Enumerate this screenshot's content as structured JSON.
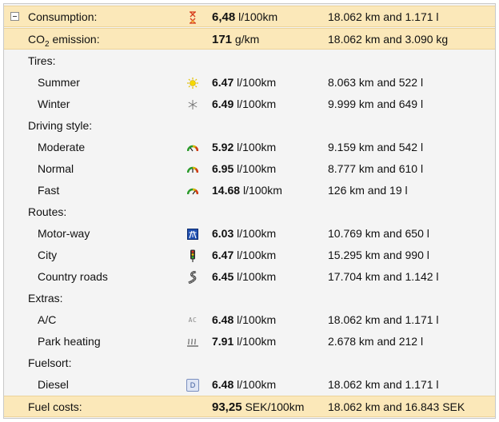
{
  "summary": {
    "consumption": {
      "label": "Consumption:",
      "value": "6,48",
      "unit": "l/100km",
      "total": "18.062 km and 1.171 l",
      "icon": "hourglass-icon"
    },
    "co2": {
      "label_prefix": "CO",
      "label_sub": "2",
      "label_suffix": " emission:",
      "value": "171",
      "unit": "g/km",
      "total": "18.062 km and 3.090 kg"
    }
  },
  "sections": {
    "tires": {
      "title": "Tires:",
      "items": [
        {
          "label": "Summer",
          "value": "6.47",
          "unit": "l/100km",
          "total": "8.063 km and 522 l",
          "icon": "sun-icon"
        },
        {
          "label": "Winter",
          "value": "6.49",
          "unit": "l/100km",
          "total": "9.999 km and 649 l",
          "icon": "snowflake-icon"
        }
      ]
    },
    "driving": {
      "title": "Driving style:",
      "items": [
        {
          "label": "Moderate",
          "value": "5.92",
          "unit": "l/100km",
          "total": "9.159 km and 542 l",
          "icon": "gauge-icon"
        },
        {
          "label": "Normal",
          "value": "6.95",
          "unit": "l/100km",
          "total": "8.777 km and 610 l",
          "icon": "gauge-icon"
        },
        {
          "label": "Fast",
          "value": "14.68",
          "unit": "l/100km",
          "total": "126 km and 19 l",
          "icon": "gauge-icon"
        }
      ]
    },
    "routes": {
      "title": "Routes:",
      "items": [
        {
          "label": "Motor-way",
          "value": "6.03",
          "unit": "l/100km",
          "total": "10.769 km and 650 l",
          "icon": "motorway-sign-icon"
        },
        {
          "label": "City",
          "value": "6.47",
          "unit": "l/100km",
          "total": "15.295 km and 990 l",
          "icon": "traffic-light-icon"
        },
        {
          "label": "Country roads",
          "value": "6.45",
          "unit": "l/100km",
          "total": "17.704 km and 1.142 l",
          "icon": "winding-road-icon"
        }
      ]
    },
    "extras": {
      "title": "Extras:",
      "items": [
        {
          "label": "A/C",
          "value": "6.48",
          "unit": "l/100km",
          "total": "18.062 km and 1.171 l",
          "icon": "ac-icon",
          "icon_text": "AC"
        },
        {
          "label": "Park heating",
          "value": "7.91",
          "unit": "l/100km",
          "total": "2.678 km and 212 l",
          "icon": "heating-icon"
        }
      ]
    },
    "fuelsort": {
      "title": "Fuelsort:",
      "items": [
        {
          "label": "Diesel",
          "value": "6.48",
          "unit": "l/100km",
          "total": "18.062 km and 1.171 l",
          "icon": "diesel-icon",
          "icon_text": "D"
        }
      ]
    }
  },
  "costs": {
    "label": "Fuel costs:",
    "value": "93,25",
    "unit": "SEK/100km",
    "total": "18.062 km and 16.843 SEK"
  }
}
